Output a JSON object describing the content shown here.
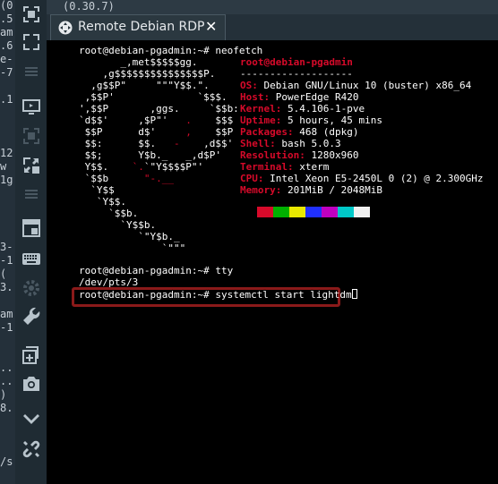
{
  "background": {
    "left_fragments": [
      "(0.30.7)",
      ".5",
      "am",
      ".6",
      "e-",
      "-7",
      "",
      ".1",
      "",
      "",
      "",
      "12",
      "w",
      "1g",
      "",
      "",
      "",
      "",
      "3-",
      "-1",
      "(",
      "3.",
      "",
      "am",
      "-1",
      "",
      "",
      "..",
      "..",
      ")",
      "8.",
      "",
      "",
      "",
      "/s",
      ""
    ],
    "top_text": "(0.30.7)"
  },
  "sidebar": {
    "icons": [
      "collapse-icon",
      "fullscreen-icon",
      "list-icon",
      "display-icon",
      "screen-region-icon",
      "window-expand-icon",
      "list-icon",
      "window-layout-icon",
      "keyboard-icon",
      "gear-icon",
      "wrench-icon",
      "add-window-icon",
      "camera-icon",
      "chevron-down-icon",
      "disconnect-icon"
    ]
  },
  "tab": {
    "title": "Remote Debian RDP",
    "close_glyph": "✕"
  },
  "terminal": {
    "prompt": "root@debian-pgadmin:~# ",
    "cmd1": "neofetch",
    "hostname": "root@debian-pgadmin",
    "separator": "-------------------",
    "info": [
      {
        "key": "OS",
        "value": "Debian GNU/Linux 10 (buster) x86_64"
      },
      {
        "key": "Host",
        "value": "PowerEdge R420"
      },
      {
        "key": "Kernel",
        "value": "5.4.106-1-pve"
      },
      {
        "key": "Uptime",
        "value": "5 hours, 45 mins"
      },
      {
        "key": "Packages",
        "value": "468 (dpkg)"
      },
      {
        "key": "Shell",
        "value": "bash 5.0.3"
      },
      {
        "key": "Resolution",
        "value": "1280x960"
      },
      {
        "key": "Terminal",
        "value": "xterm"
      },
      {
        "key": "CPU",
        "value": "Intel Xeon E5-2450L 0 (2) @ 2.300GHz"
      },
      {
        "key": "Memory",
        "value": "201MiB / 2048MiB"
      }
    ],
    "palette": [
      "#d70a2a",
      "#00b000",
      "#e8e800",
      "#2030ff",
      "#c000c0",
      "#00c8c8",
      "#f0f0f0"
    ],
    "cmd2": "tty",
    "tty_output": "/dev/pts/3",
    "cmd3": "systemctl start lightdm"
  }
}
